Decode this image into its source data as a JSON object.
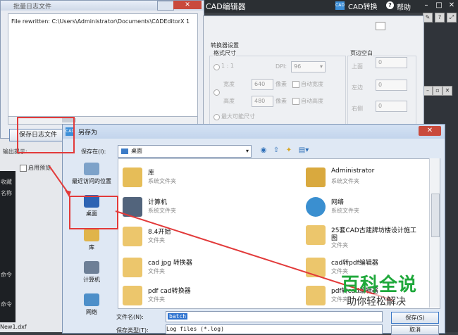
{
  "app": {
    "title": "CAD编辑器",
    "converter_label": "CAD转换",
    "help_label": "帮助"
  },
  "log_window": {
    "title": "批量日志文件",
    "log_line": "File rewritten: C:\\Users\\Administrator\\Documents\\CADEditorX 1",
    "save_button": "保存日志文件",
    "output_hint": "输出提示:",
    "preview_label": "启用预览"
  },
  "left_panel": {
    "labels": [
      "收藏",
      "名称",
      "命令",
      "命令"
    ],
    "status": "New1.dxf"
  },
  "converter": {
    "section_title": "转换器设置",
    "format_size": "格式尺寸",
    "ratio": "1 : 1",
    "dpi_label": "DPI:",
    "dpi_value": "96",
    "width_label": "宽度",
    "width_value": "640",
    "height_label": "高度",
    "height_value": "480",
    "pixel_unit": "像素",
    "auto_width": "自动宽度",
    "auto_height": "自动高度",
    "max_size": "最大可能尺寸",
    "margins_title": "页边空白",
    "top_label": "上面",
    "left_label": "左边",
    "right_label": "右侧",
    "margin_top": "0",
    "margin_left": "0",
    "margin_right": "0"
  },
  "saveas": {
    "title": "另存为",
    "save_in_label": "保存在(I):",
    "save_in_value": "桌面",
    "places": [
      "最近访问的位置",
      "桌面",
      "库",
      "计算机",
      "网络"
    ],
    "files": [
      {
        "name": "库",
        "type": "系统文件夹"
      },
      {
        "name": "Administrator",
        "type": "系统文件夹"
      },
      {
        "name": "计算机",
        "type": "系统文件夹"
      },
      {
        "name": "网络",
        "type": "系统文件夹"
      },
      {
        "name": "8.4开始",
        "type": "文件夹"
      },
      {
        "name": "25套CAD古建牌坊楼设计施工",
        "name2": "图",
        "type": "文件夹"
      },
      {
        "name": "cad jpg 转换器",
        "type": "文件夹"
      },
      {
        "name": "cad转pdf编辑器",
        "type": "文件夹"
      },
      {
        "name": "pdf cad转换器",
        "type": "文件夹"
      },
      {
        "name": "pdf转cad编辑器",
        "type": "文件夹"
      }
    ],
    "filename_label": "文件名(N):",
    "filename_value": "batch",
    "filetype_label": "保存类型(T):",
    "filetype_value": "Log files (*.log)",
    "save_button": "保存(S)",
    "cancel_button": "取消"
  },
  "watermark": {
    "main": "百科全说",
    "sub": "助你轻松解决"
  },
  "colors": {
    "annotation_red": "#e23a3a",
    "watermark_green": "#1fa83b",
    "accent_blue": "#3d8fd8"
  }
}
